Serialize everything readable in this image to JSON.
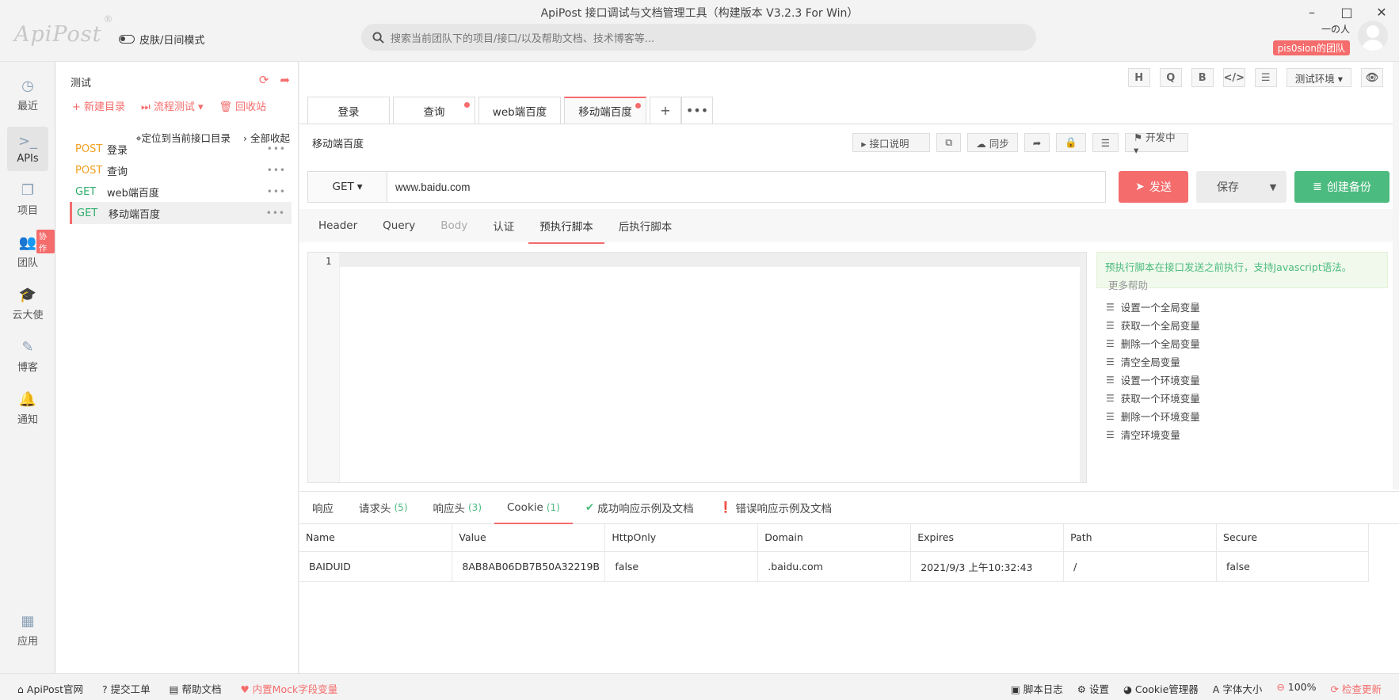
{
  "window": {
    "title": "ApiPost 接口调试与文档管理工具（构建版本 V3.2.3 For Win）",
    "logo": "ApiPost",
    "logo_mark": "®",
    "theme_toggle": "皮肤/日间模式",
    "search_placeholder": "搜索当前团队下的项目/接口/以及帮助文档、技术博客等...",
    "user_name": "一の人",
    "team_badge": "pis0sion的团队",
    "controls": {
      "minimize": "–",
      "maximize": "□",
      "close": "✕"
    }
  },
  "leftnav": {
    "items": [
      {
        "label": "最近",
        "icon": "clock-icon",
        "glyph": "◷"
      },
      {
        "label": "APIs",
        "icon": "terminal-icon",
        "glyph": ">_"
      },
      {
        "label": "项目",
        "icon": "project-icon",
        "glyph": "❐"
      },
      {
        "label": "团队",
        "icon": "team-icon",
        "glyph": "👥"
      },
      {
        "label": "云大使",
        "icon": "graduation-cap-icon",
        "glyph": "🎓"
      },
      {
        "label": "博客",
        "icon": "edit-icon",
        "glyph": "✎"
      },
      {
        "label": "通知",
        "icon": "bell-icon",
        "glyph": "🔔"
      },
      {
        "label": "应用",
        "icon": "apps-icon",
        "glyph": "▦"
      }
    ],
    "collab_badge": "协作"
  },
  "tree": {
    "title": "测试",
    "actions": {
      "new_folder": "+ 新建目录",
      "flow_test": "⏭ 流程测试 ▾",
      "recycle": "🗑 回收站"
    },
    "locate": "定位到当前接口目录",
    "collapse_all": "全部收起",
    "apis": [
      {
        "method": "POST",
        "name": "登录"
      },
      {
        "method": "POST",
        "name": "查询"
      },
      {
        "method": "GET",
        "name": "web端百度"
      },
      {
        "method": "GET",
        "name": "移动端百度"
      }
    ],
    "more": "•••"
  },
  "topicons": {
    "items": [
      "H",
      "Q",
      "B",
      "</>",
      "☰"
    ],
    "env": "测试环境 ▾",
    "eye": "👁"
  },
  "tabs": {
    "items": [
      {
        "label": "登录",
        "dot": false
      },
      {
        "label": "查询",
        "dot": true
      },
      {
        "label": "web端百度",
        "dot": false
      },
      {
        "label": "移动端百度",
        "dot": true
      }
    ],
    "add": "+",
    "more": "•••"
  },
  "request": {
    "breadcrumb": "移动端百度",
    "doc_btn": "▸ 接口说明",
    "sync_btn": "☁ 同步",
    "status": "⚑ 开发中 ▾",
    "method": "GET",
    "url": "www.baidu.com",
    "send": "发送",
    "save": "保存",
    "backup": "创建备份"
  },
  "subtabs": [
    "Header",
    "Query",
    "Body",
    "认证",
    "预执行脚本",
    "后执行脚本"
  ],
  "editor": {
    "line": "1"
  },
  "help": {
    "text": "预执行脚本在接口发送之前执行，支持Javascript语法。",
    "more": "更多帮助",
    "snippets": [
      "设置一个全局变量",
      "获取一个全局变量",
      "删除一个全局变量",
      "清空全局变量",
      "设置一个环境变量",
      "获取一个环境变量",
      "删除一个环境变量",
      "清空环境变量"
    ]
  },
  "response": {
    "tabs": [
      {
        "label": "响应",
        "count": ""
      },
      {
        "label": "请求头",
        "count": "(5)"
      },
      {
        "label": "响应头",
        "count": "(3)"
      },
      {
        "label": "Cookie",
        "count": "(1)"
      },
      {
        "label": "成功响应示例及文档",
        "count": ""
      },
      {
        "label": "错误响应示例及文档",
        "count": ""
      }
    ],
    "columns": [
      "Name",
      "Value",
      "HttpOnly",
      "Domain",
      "Expires",
      "Path",
      "Secure"
    ],
    "rows": [
      [
        "BAIDUID",
        "8AB8AB06DB7B50A32219B",
        "false",
        ".baidu.com",
        "2021/9/3 上午10:32:43",
        "/",
        "false"
      ]
    ]
  },
  "statusbar": {
    "left": [
      "ApiPost官网",
      "提交工单",
      "帮助文档",
      "内置Mock字段变量"
    ],
    "right": [
      "脚本日志",
      "设置",
      "Cookie管理器",
      "字体大小",
      "100%",
      "检查更新"
    ]
  },
  "colors": {
    "accent": "#f56c6c",
    "success": "#4cbb7f",
    "post": "#f0a020",
    "get": "#2eae6b"
  }
}
